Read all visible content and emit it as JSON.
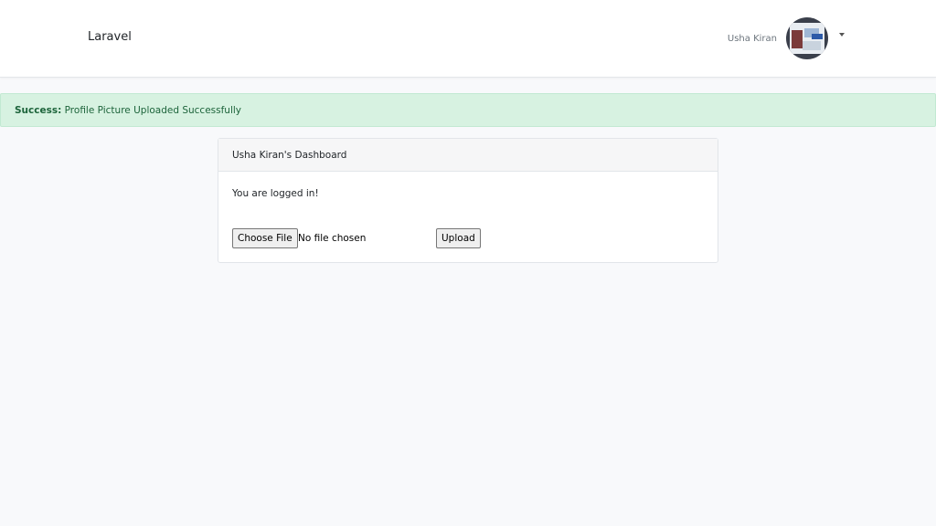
{
  "navbar": {
    "brand": "Laravel",
    "user_name": "Usha Kiran",
    "avatar_icon": "user-avatar",
    "dropdown_icon": "caret-down-icon"
  },
  "alert": {
    "label": "Success:",
    "message": "Profile Picture Uploaded Successfully"
  },
  "card": {
    "header": "Usha Kiran's Dashboard",
    "status_text": "You are logged in!",
    "file_button": "Choose File",
    "file_status": "No file chosen",
    "upload_button": "Upload"
  },
  "colors": {
    "page_bg": "#f8f9fb",
    "alert_bg": "#d7f2e1",
    "alert_text": "#1d643b"
  }
}
